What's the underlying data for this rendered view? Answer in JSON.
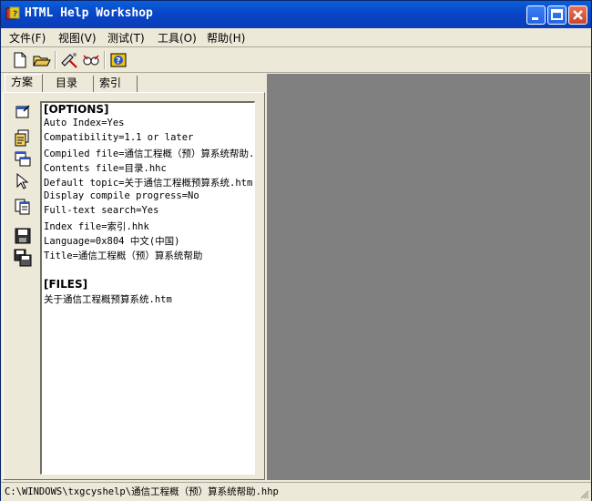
{
  "window": {
    "title": "HTML Help Workshop",
    "title_icon": "help-book-icon"
  },
  "menu": [
    {
      "label": "文件(F)"
    },
    {
      "label": "视图(V)"
    },
    {
      "label": "测试(T)"
    },
    {
      "label": "工具(O)"
    },
    {
      "label": "帮助(H)"
    }
  ],
  "toolbar": {
    "buttons": [
      {
        "icon": "new-file-icon"
      },
      {
        "icon": "open-folder-icon"
      },
      {
        "icon": "compile-icon"
      },
      {
        "icon": "view-compiled-icon"
      },
      {
        "icon": "help-icon"
      }
    ]
  },
  "tabs": [
    {
      "label": "方案"
    },
    {
      "label": "目录"
    },
    {
      "label": "索引"
    }
  ],
  "sidebar_buttons": [
    {
      "icon": "change-options-icon"
    },
    {
      "icon": "add-remove-files-icon"
    },
    {
      "icon": "add-modify-window-icon"
    },
    {
      "icon": "html-help-api-icon"
    },
    {
      "icon": "view-html-source-icon"
    },
    {
      "icon": "save-project-icon"
    },
    {
      "icon": "save-and-compile-icon"
    }
  ],
  "editor": {
    "lines": [
      "[OPTIONS]",
      "Auto Index=Yes",
      "Compatibility=1.1 or later",
      "Compiled file=通信工程概（预）算系统帮助.chm",
      "Contents file=目录.hhc",
      "Default topic=关于通信工程概预算系统.htm",
      "Display compile progress=No",
      "Full-text search=Yes",
      "Index file=索引.hhk",
      "Language=0x804 中文(中国)",
      "Title=通信工程概（预）算系统帮助",
      "",
      "[FILES]",
      "关于通信工程概预算系统.htm"
    ]
  },
  "status": {
    "path": "C:\\WINDOWS\\txgcyshelp\\通信工程概（预）算系统帮助.hhp"
  },
  "colors": {
    "titlebar": "#0846c8",
    "face": "#ece9d8",
    "workspace": "#808080"
  }
}
